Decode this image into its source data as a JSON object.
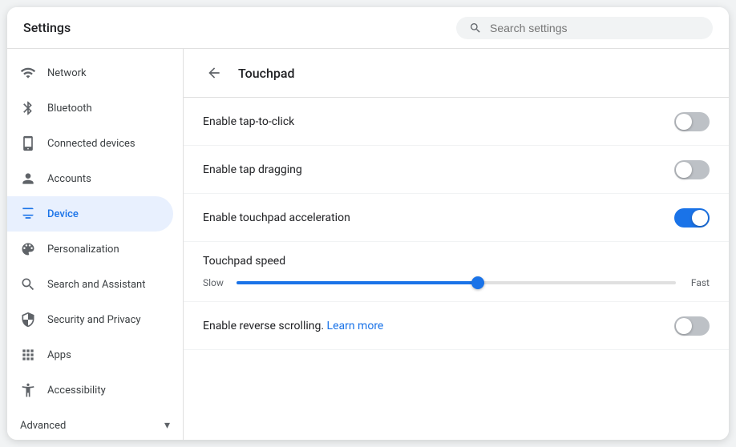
{
  "header": {
    "title": "Settings",
    "search_placeholder": "Search settings"
  },
  "sidebar": {
    "items": [
      {
        "id": "network",
        "label": "Network",
        "icon": "network"
      },
      {
        "id": "bluetooth",
        "label": "Bluetooth",
        "icon": "bluetooth"
      },
      {
        "id": "connected-devices",
        "label": "Connected devices",
        "icon": "connected-devices"
      },
      {
        "id": "accounts",
        "label": "Accounts",
        "icon": "accounts"
      },
      {
        "id": "device",
        "label": "Device",
        "icon": "device",
        "active": true
      },
      {
        "id": "personalization",
        "label": "Personalization",
        "icon": "personalization"
      },
      {
        "id": "search-assistant",
        "label": "Search and Assistant",
        "icon": "search-assistant"
      },
      {
        "id": "security-privacy",
        "label": "Security and Privacy",
        "icon": "security-privacy"
      },
      {
        "id": "apps",
        "label": "Apps",
        "icon": "apps"
      },
      {
        "id": "accessibility",
        "label": "Accessibility",
        "icon": "accessibility"
      }
    ],
    "advanced_label": "Advanced",
    "advanced_arrow": "▾"
  },
  "main": {
    "back_button_title": "Back",
    "page_title": "Touchpad",
    "settings": [
      {
        "id": "tap-to-click",
        "label": "Enable tap-to-click",
        "type": "toggle",
        "enabled": false
      },
      {
        "id": "tap-dragging",
        "label": "Enable tap dragging",
        "type": "toggle",
        "enabled": false
      },
      {
        "id": "touchpad-acceleration",
        "label": "Enable touchpad acceleration",
        "type": "toggle",
        "enabled": true
      },
      {
        "id": "touchpad-speed",
        "label": "Touchpad speed",
        "type": "slider",
        "slow_label": "Slow",
        "fast_label": "Fast",
        "value": 55
      },
      {
        "id": "reverse-scrolling",
        "label": "Enable reverse scrolling.",
        "link_text": "Learn more",
        "type": "toggle",
        "enabled": false
      }
    ]
  }
}
